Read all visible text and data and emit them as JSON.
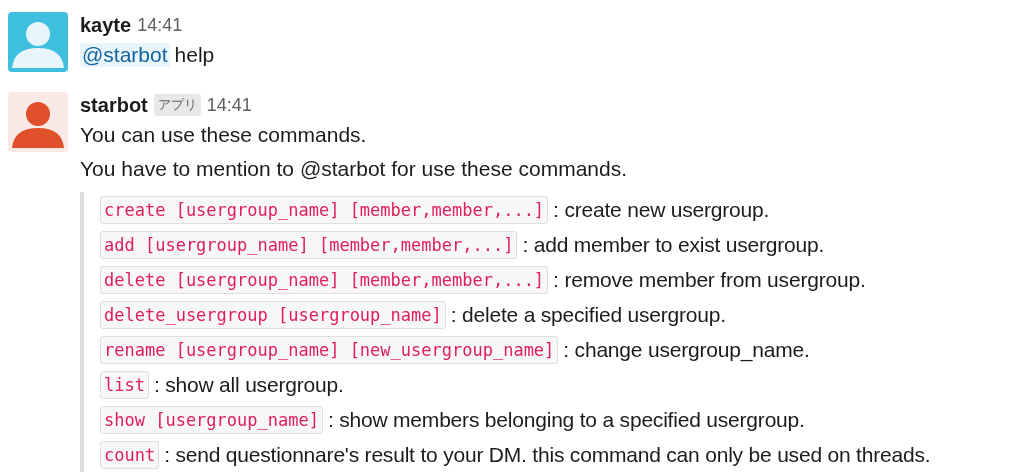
{
  "messages": [
    {
      "author": "kayte",
      "time": "14:41",
      "avatar": {
        "kind": "user",
        "color": "#3ebfe0"
      },
      "mention": "@starbot",
      "text": "help"
    },
    {
      "author": "starbot",
      "badge": "アプリ",
      "time": "14:41",
      "avatar": {
        "kind": "app",
        "color": "#fbe9e7"
      },
      "lines": [
        "You can use these commands.",
        "You have to mention to @starbot for use these commands."
      ],
      "commands": [
        {
          "code": "create [usergroup_name] [member,member,...]",
          "description": ": create new usergroup."
        },
        {
          "code": "add [usergroup_name] [member,member,...]",
          "description": ": add member to exist usergroup."
        },
        {
          "code": "delete [usergroup_name] [member,member,...]",
          "description": ": remove member from usergroup."
        },
        {
          "code": "delete_usergroup [usergroup_name]",
          "description": ": delete a specified usergroup."
        },
        {
          "code": "rename [usergroup_name] [new_usergroup_name]",
          "description": ": change usergroup_name."
        },
        {
          "code": "list",
          "description": ": show all usergroup."
        },
        {
          "code": "show [usergroup_name]",
          "description": ": show members belonging to a specified usergroup."
        },
        {
          "code": "count",
          "description": ": send questionnare's result to your DM. this command can only be used on threads."
        }
      ]
    }
  ]
}
